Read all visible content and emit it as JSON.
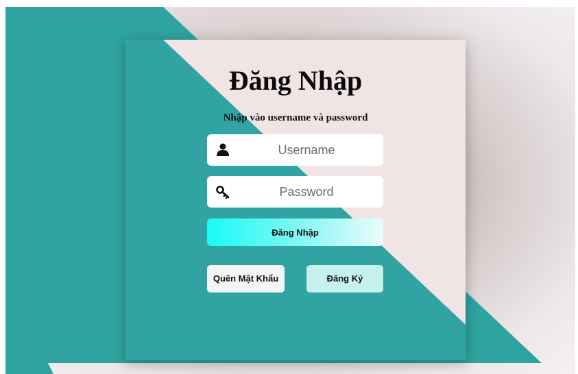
{
  "login_form": {
    "title": "Đăng Nhập",
    "subtitle": "Nhập vào username và password",
    "username": {
      "placeholder": "Username",
      "value": "",
      "icon": "user-icon"
    },
    "password": {
      "placeholder": "Password",
      "value": "",
      "icon": "key-icon"
    },
    "login_button": "Đăng Nhập",
    "forgot_button": "Quên Mật Khẩu",
    "register_button": "Đăng Ký"
  },
  "colors": {
    "teal": "#31a3a2",
    "pink_panel": "#f1e4e4",
    "login_gradient_start": "#18fbf6",
    "register_button": "#c5f1ec"
  }
}
